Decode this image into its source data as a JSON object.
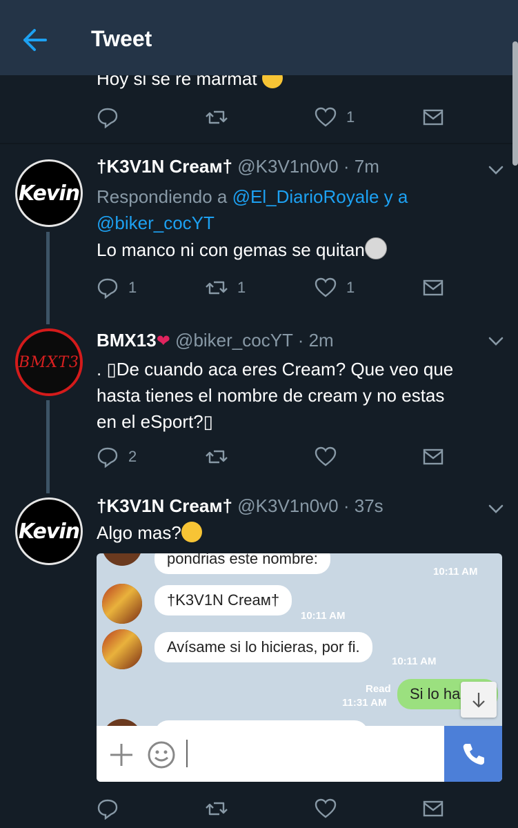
{
  "header": {
    "title": "Tweet"
  },
  "colors": {
    "background": "#141d26",
    "header": "#243447",
    "link": "#1da1f2",
    "muted": "#8899a6",
    "heart": "#e0245e"
  },
  "tweets": [
    {
      "text": "Hoy si se re marmat",
      "text_emoji": "laughing-face",
      "actions": {
        "reply": "",
        "retweet": "",
        "like": "1"
      }
    },
    {
      "name": "†K3V1N Creaм†",
      "handle": "@K3V1n0v0",
      "time": "· 7m",
      "reply_prefix": "Respondiendo a",
      "reply_user1": "@El_DiarioRoyale",
      "reply_and": "y a",
      "reply_user2": "@biker_cocYT",
      "text": "Lo manco ni con gemas se quitan",
      "text_emoji": "smiling-moon",
      "avatar_text": "Kevin",
      "actions": {
        "reply": "1",
        "retweet": "1",
        "like": "1"
      }
    },
    {
      "name": "BMX13",
      "name_emoji": "red-heart",
      "handle": "@biker_cocYT",
      "time": "· 2m",
      "text_line1": ". ▯De cuando aca eres Cream? Que veo que",
      "text_line2": "hasta tienes el  nombre de cream y no estas",
      "text_line3": "en el eSport?▯",
      "avatar_text": "BMXT3",
      "actions": {
        "reply": "2",
        "retweet": "",
        "like": ""
      }
    },
    {
      "name": "†K3V1N Creaм†",
      "handle": "@K3V1n0v0",
      "time": "· 37s",
      "text": "Algo mas?",
      "text_emoji": "winking-face",
      "avatar_text": "Kevin",
      "actions": {
        "reply": "",
        "retweet": "",
        "like": ""
      }
    }
  ],
  "chat": {
    "messages": [
      {
        "text": "pondrias este nombre:",
        "time": "10:11 AM"
      },
      {
        "text": "†K3V1N Creaм†",
        "time": "10:11 AM"
      },
      {
        "text": "Avísame si lo hicieras, por fi.",
        "time": "10:11 AM"
      },
      {
        "text": "Si lo hare",
        "time": "11:31 AM",
        "status": "Read"
      }
    ],
    "input_placeholder": ""
  }
}
